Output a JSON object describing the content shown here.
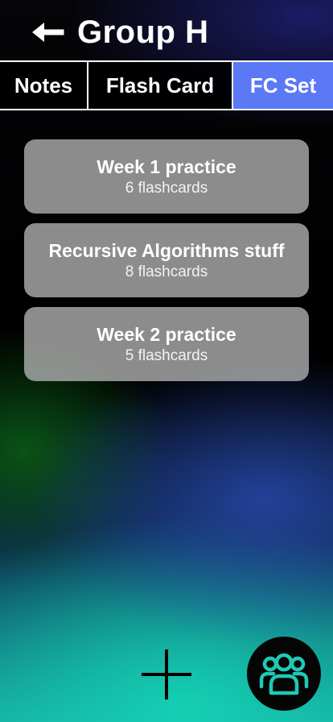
{
  "header": {
    "back_icon": "arrow-left-icon",
    "title": "Group H"
  },
  "tabs": [
    {
      "label": "Notes",
      "active": false
    },
    {
      "label": "Flash Card",
      "active": false
    },
    {
      "label": "FC Set",
      "active": true
    }
  ],
  "flashcard_sets": [
    {
      "title": "Week 1 practice",
      "count": "6 flashcards"
    },
    {
      "title": "Recursive Algorithms stuff",
      "count": "8 flashcards"
    },
    {
      "title": "Week 2 practice",
      "count": "5 flashcards"
    }
  ],
  "bottom": {
    "add_icon": "plus-icon",
    "group_icon": "group-members-icon"
  },
  "colors": {
    "active_tab": "#5b78f5",
    "card_background": "#b4b4b4",
    "group_icon": "#1fc9b6"
  }
}
